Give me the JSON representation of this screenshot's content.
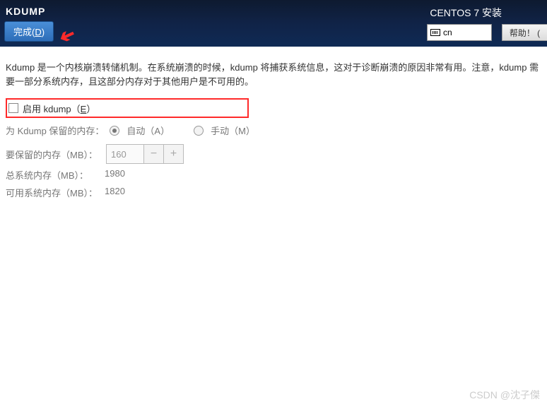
{
  "header": {
    "title": "KDUMP",
    "installer": "CENTOS 7 安装",
    "done_prefix": "完成(",
    "done_mn": "D",
    "done_suffix": ")",
    "lang": "cn",
    "help": "帮助！ ("
  },
  "desc": "Kdump 是一个内核崩溃转储机制。在系统崩溃的时候，kdump 将捕获系统信息，这对于诊断崩溃的原因非常有用。注意，kdump 需要一部分系统内存，且这部分内存对于其他用户是不可用的。",
  "enable": {
    "prefix": "启用 kdump（",
    "mn": "E",
    "suffix": "）"
  },
  "reserve": {
    "label": "为 Kdump 保留的内存：",
    "auto": "自动（A）",
    "manual": "手动（M）"
  },
  "mem": {
    "need_label": "要保留的内存（MB）：",
    "need_value": "160",
    "total_label": "总系统内存（MB）：",
    "total_value": "1980",
    "avail_label": "可用系统内存（MB）：",
    "avail_value": "1820"
  },
  "watermark": "CSDN @沈子傑"
}
